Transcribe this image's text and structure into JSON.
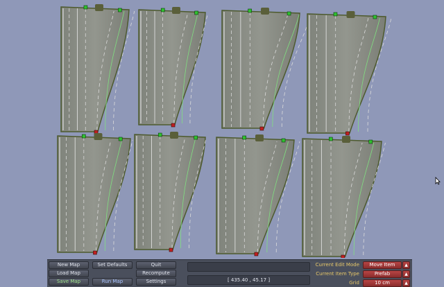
{
  "toolbar": {
    "new_map": "New Map",
    "load_map": "Load Map",
    "save_map": "Save Map",
    "set_defaults": "Set Defaults",
    "run_map": "Run Map",
    "quit": "Quit",
    "recompute": "Recompute",
    "settings": "Settings"
  },
  "status": {
    "message": "",
    "coordinates": "[ 435.40 , 45.17 ]"
  },
  "edit": {
    "mode_label": "Current Edit Mode",
    "mode_value": "Move Item",
    "type_label": "Current Item Type",
    "type_value": "Prefab",
    "grid_label": "Grid",
    "grid_value": "10 cm"
  },
  "colors": {
    "background": "#8f98b8",
    "road": "#8b8e86",
    "node_start": "#30c030",
    "node_end": "#c02020"
  },
  "icons": {
    "arrow": "triangle-up",
    "cursor": "mouse-pointer"
  }
}
